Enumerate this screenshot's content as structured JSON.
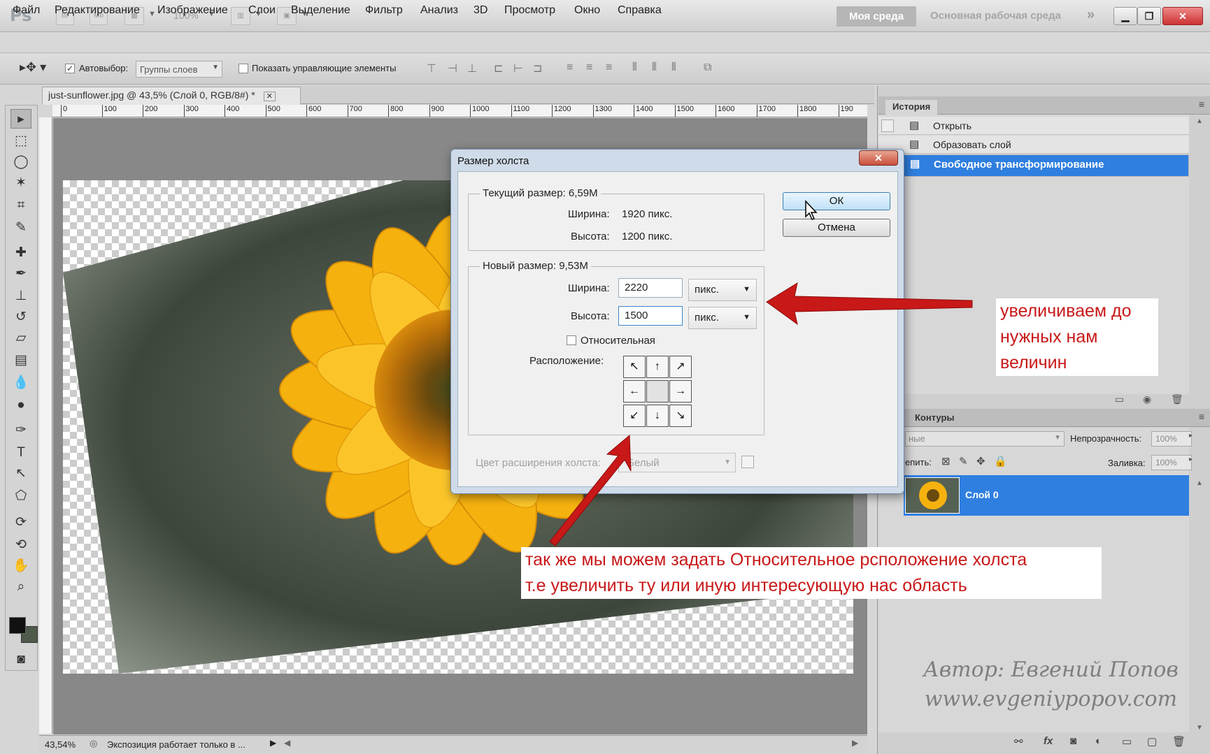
{
  "app": {
    "logo": "Ps",
    "bridge": "Br",
    "minibridge": "Mb",
    "zoom": "100%",
    "workspace_active": "Моя среда",
    "workspace_main": "Основная рабочая среда",
    "more": "»"
  },
  "menu": [
    "Файл",
    "Редактирование",
    "Изображение",
    "Слои",
    "Выделение",
    "Фильтр",
    "Анализ",
    "3D",
    "Просмотр",
    "Окно",
    "Справка"
  ],
  "options": {
    "autoselect_label": "Автовыбор:",
    "autoselect_value": "Группы слоев",
    "show_controls": "Показать управляющие элементы"
  },
  "document": {
    "tab_title": "just-sunflower.jpg @ 43,5% (Слой 0, RGB/8#) *",
    "ruler_ticks": [
      "0",
      "100",
      "200",
      "300",
      "400",
      "500",
      "600",
      "700",
      "800",
      "900",
      "1000",
      "1100",
      "1200",
      "1300",
      "1400",
      "1500",
      "1600",
      "1700",
      "1800",
      "190"
    ]
  },
  "status": {
    "zoom": "43,54%",
    "message": "Экспозиция работает только в ..."
  },
  "history": {
    "title": "История",
    "items": [
      "Открыть",
      "Образовать слой",
      "Свободное трансформирование"
    ],
    "selected_index": 2
  },
  "layers": {
    "tab": "Контуры",
    "blend_mode": "ные",
    "opacity_label": "Непрозрачность:",
    "opacity_value": "100%",
    "lock_label": "епить:",
    "fill_label": "Заливка:",
    "fill_value": "100%",
    "layer_name": "Слой 0"
  },
  "dialog": {
    "title": "Размер холста",
    "current_size": "Текущий размер:  6,59M",
    "width_label": "Ширина:",
    "current_width": "1920 пикс.",
    "height_label": "Высота:",
    "current_height": "1200 пикс.",
    "new_size": "Новый размер: 9,53M",
    "new_width": "2220",
    "new_height": "1500",
    "unit": "пикс.",
    "relative": "Относительная",
    "anchor_label": "Расположение:",
    "ext_color_label": "Цвет расширения холста:",
    "ext_color_value": "Белый",
    "ok": "ОК",
    "cancel": "Отмена"
  },
  "annotations": {
    "right_note": [
      "увеличиваем до",
      "нужных нам",
      "величин"
    ],
    "bottom_note": [
      "так же мы можем задать Относительное рсположение холста",
      "т.е увеличить ту или иную интересующую нас область"
    ],
    "accent": "#c81818"
  },
  "watermark": [
    "Автор: Евгений Попов",
    "www.evgeniypopov.com"
  ],
  "colors": {
    "selection": "#2f7fe0",
    "sunflower": "#f5b20f"
  }
}
